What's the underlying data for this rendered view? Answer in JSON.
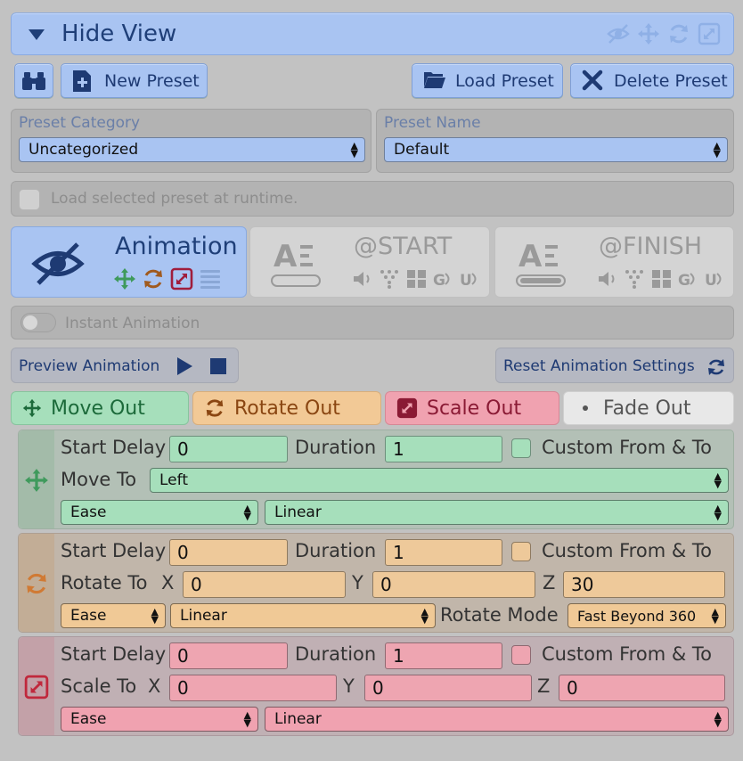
{
  "header": {
    "title": "Hide View",
    "icons": [
      "eye-slash-icon",
      "move-icon",
      "rotate-icon",
      "scale-icon"
    ]
  },
  "toolbar": {
    "search_icon": "binoculars-icon",
    "new_preset_label": "New Preset",
    "load_preset_label": "Load Preset",
    "delete_preset_label": "Delete Preset"
  },
  "preset": {
    "category_label": "Preset Category",
    "category_value": "Uncategorized",
    "name_label": "Preset Name",
    "name_value": "Default"
  },
  "load_at_runtime": {
    "label": "Load selected preset at runtime.",
    "checked": false
  },
  "tabs": {
    "animation": {
      "label": "Animation"
    },
    "start": {
      "label": "@START"
    },
    "finish": {
      "label": "@FINISH"
    }
  },
  "instant_animation": {
    "label": "Instant Animation",
    "on": false
  },
  "preview": {
    "label": "Preview Animation"
  },
  "reset": {
    "label": "Reset Animation Settings"
  },
  "categories": {
    "move": "Move Out",
    "rotate": "Rotate Out",
    "scale": "Scale Out",
    "fade": "Fade Out"
  },
  "move": {
    "start_delay_label": "Start Delay",
    "start_delay": "0",
    "duration_label": "Duration",
    "duration": "1",
    "custom_label": "Custom From & To",
    "move_to_label": "Move To",
    "move_to": "Left",
    "ease": "Ease",
    "curve": "Linear"
  },
  "rotate": {
    "start_delay_label": "Start Delay",
    "start_delay": "0",
    "duration_label": "Duration",
    "duration": "1",
    "custom_label": "Custom From & To",
    "rotate_to_label": "Rotate To",
    "x_label": "X",
    "x": "0",
    "y_label": "Y",
    "y": "0",
    "z_label": "Z",
    "z": "30",
    "ease": "Ease",
    "curve": "Linear",
    "mode_label": "Rotate Mode",
    "mode": "Fast Beyond 360"
  },
  "scale": {
    "start_delay_label": "Start Delay",
    "start_delay": "0",
    "duration_label": "Duration",
    "duration": "1",
    "custom_label": "Custom From & To",
    "scale_to_label": "Scale To",
    "x_label": "X",
    "x": "0",
    "y_label": "Y",
    "y": "0",
    "z_label": "Z",
    "z": "0",
    "ease": "Ease",
    "curve": "Linear"
  },
  "colors": {
    "accent_blue": "#a9c4f2",
    "move_green": "#a6dfbb",
    "rotate_orange": "#eec99a",
    "scale_red": "#eea5b1"
  }
}
